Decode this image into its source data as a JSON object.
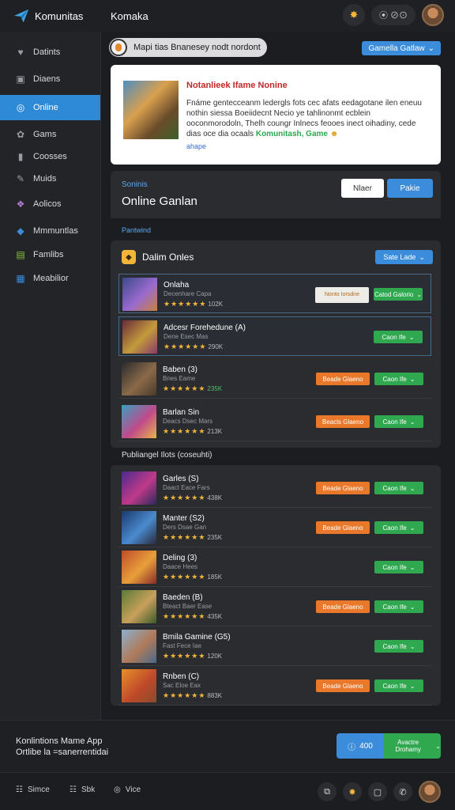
{
  "topbar": {
    "app_title": "Komunitas",
    "page_title": "Komaka",
    "controls": "⦿  ⊘⊙"
  },
  "sidebar": {
    "items": [
      {
        "label": "Datints",
        "icon": "heart-icon"
      },
      {
        "label": "Diaens",
        "icon": "square-icon"
      },
      {
        "label": "Online",
        "icon": "circle-icon",
        "active": true
      },
      {
        "label": "Gams",
        "icon": "gear-icon"
      },
      {
        "label": "Coosses",
        "icon": "book-icon"
      },
      {
        "label": "Muids",
        "icon": "pencil-icon"
      },
      {
        "label": "Aolicos",
        "icon": "grid-icon"
      },
      {
        "label": "Mmmuntlas",
        "icon": "diamond-icon"
      },
      {
        "label": "Famlibs",
        "icon": "chart-icon"
      },
      {
        "label": "Meabilior",
        "icon": "photo-icon"
      }
    ]
  },
  "main": {
    "search_text": "Mapi tias Bnanesey nodt nordont",
    "top_dropdown": "Gamella Gatlaw",
    "ad": {
      "title": "Notanlieek Ifame Nonine",
      "text": "Fnáme gentecceanm ledergls fots cec afats eedagotane ilen eneuu nothin siessa Boeiidecnt Necio ye tahlinonmt ecblein ooconmorodoln, Thelh coungr Inlnecs feooes inect oihadiny, cede dias oce dia ocaals",
      "highlight": "Komunitash, Game",
      "link": "ahape"
    },
    "online_header": {
      "small": "Soninis",
      "title": "Online Ganlan",
      "btn_white": "Nlaer",
      "btn_blue": "Pakie"
    },
    "filter_link": "Pantwind",
    "panel_a": {
      "title": "Dalim Onles",
      "dropdown": "Sate Lade",
      "rows": [
        {
          "name": "Onlaha",
          "sub": "Decenhare Capa",
          "count": "102K",
          "count_green": false,
          "btn1": "Nonto Iorsdne",
          "btn1_style": "light",
          "btn2": "Catod Galorio",
          "thumb": [
            "#3a4a8a",
            "#9a6acf",
            "#c8813d"
          ]
        },
        {
          "name": "Adcesr Forehedune (A)",
          "sub": "Dene Esec Mas",
          "count": "290K",
          "count_green": false,
          "btn1": "",
          "btn1_style": "none",
          "btn2": "Caon Ife",
          "thumb": [
            "#6a2a3a",
            "#c39b3b",
            "#8a3a6a"
          ]
        },
        {
          "name": "Baben (3)",
          "sub": "Bnes Eame",
          "count": "235K",
          "count_green": true,
          "btn1": "Beade Glaeno",
          "btn1_style": "orange",
          "btn2": "Caon Ife",
          "thumb": [
            "#2a2a2a",
            "#8a6a4a",
            "#4a3a2a"
          ]
        },
        {
          "name": "Barlan Sin",
          "sub": "Deacs Dsec Mars",
          "count": "213K",
          "count_green": false,
          "btn1": "Beacls Glaeno",
          "btn1_style": "orange",
          "btn2": "Caon Ife",
          "thumb": [
            "#3aa0c0",
            "#c04a8a",
            "#e8b34a"
          ]
        }
      ]
    },
    "section_label": "Publiangel Ilots (coseuhti)",
    "panel_b": {
      "rows": [
        {
          "name": "Garles (S)",
          "sub": "Daact Eace Fars",
          "count": "438K",
          "btn1": "Beade Glaeno",
          "btn1_style": "orange",
          "btn2": "Caon Ife",
          "thumb": [
            "#4a2a8a",
            "#c03a8a",
            "#2a2a5a"
          ]
        },
        {
          "name": "Manter (S2)",
          "sub": "Ders Dsae Gan",
          "count": "235K",
          "btn1": "Beade Glaeno",
          "btn1_style": "orange",
          "btn2": "Caon Ife",
          "thumb": [
            "#1a3a6a",
            "#4a8acf",
            "#2a2a3a"
          ]
        },
        {
          "name": "Deling (3)",
          "sub": "Daace Hees",
          "count": "185K",
          "btn1": "",
          "btn1_style": "none",
          "btn2": "Caon Ife",
          "thumb": [
            "#c04a2a",
            "#e8a03a",
            "#8a2a2a"
          ]
        },
        {
          "name": "Baeden (B)",
          "sub": "Bteact Baer Ease",
          "count": "435K",
          "btn1": "Beade Glaeno",
          "btn1_style": "orange",
          "btn2": "Caon Ife",
          "thumb": [
            "#5a7a3a",
            "#c8a05a",
            "#3a5a2a"
          ]
        },
        {
          "name": "Bmila Gamine (G5)",
          "sub": "Fast Fece Iae",
          "count": "120K",
          "btn1": "",
          "btn1_style": "none",
          "btn2": "Caon Ife",
          "thumb": [
            "#8ab0d0",
            "#b07a5a",
            "#4a6a8a"
          ]
        },
        {
          "name": "Rnben (C)",
          "sub": "Sac Eloe Eax",
          "count": "883K",
          "btn1": "Beade Glaeno",
          "btn1_style": "orange",
          "btn2": "Caon Ife",
          "thumb": [
            "#e8902a",
            "#c04a2a",
            "#8a4a2a"
          ]
        }
      ]
    }
  },
  "footer": {
    "line1": "Konlintions Mame App",
    "line2": "Ortlibe la =sanerrentidai",
    "btn_blue": "400",
    "btn_green": "Avactre Drohamy"
  },
  "bottombar": {
    "item1": "Simce",
    "item2": "Sbk",
    "item3": "Vice"
  },
  "colors": {
    "accent_blue": "#3b8ddb",
    "active_blue": "#2e89d6",
    "green": "#2fa84f",
    "orange": "#e9782a",
    "star": "#f1b53a"
  }
}
